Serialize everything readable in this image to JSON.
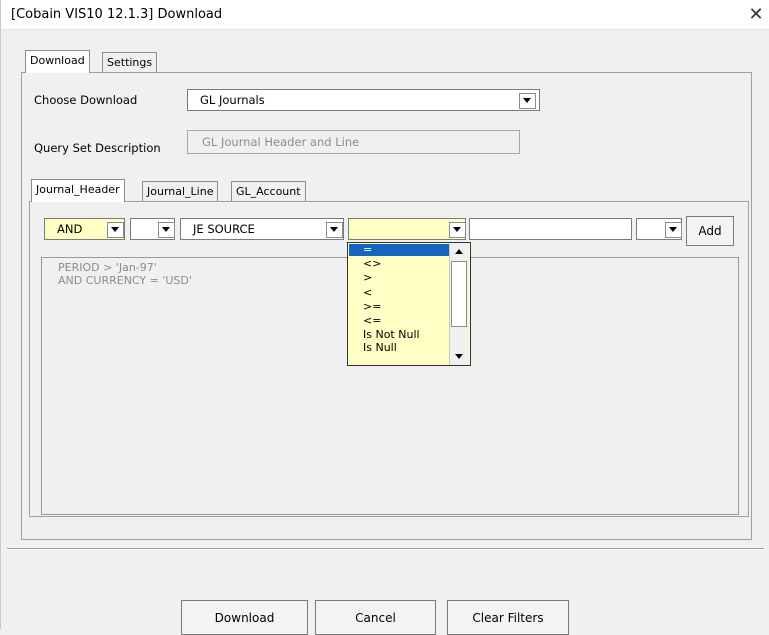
{
  "window": {
    "title": "[Cobain VIS10 12.1.3] Download",
    "close_glyph": "✕"
  },
  "tabs": [
    "Download",
    "Settings"
  ],
  "choose_download": {
    "label": "Choose Download",
    "value": "GL Journals"
  },
  "query_set": {
    "label": "Query Set Description",
    "value": "GL Journal Header and Line"
  },
  "subtabs": [
    "Journal_Header",
    "Journal_Line",
    "GL_Account"
  ],
  "filter_row": {
    "conjunction": "AND",
    "paren": "",
    "field": "JE SOURCE",
    "operator": "",
    "value": "",
    "close_paren": "",
    "add_label": "Add"
  },
  "operator_options": [
    "=",
    "<>",
    ">",
    "<",
    ">=",
    "<=",
    "Is Not Null",
    "Is Null"
  ],
  "operator_selected": "=",
  "query_text": [
    "PERIOD > 'Jan-97'",
    "AND CURRENCY = 'USD'"
  ],
  "buttons": {
    "download": "Download",
    "cancel": "Cancel",
    "clear_filters": "Clear Filters"
  },
  "colors": {
    "highlight": "#ffffc5",
    "selection": "#1565c0"
  }
}
